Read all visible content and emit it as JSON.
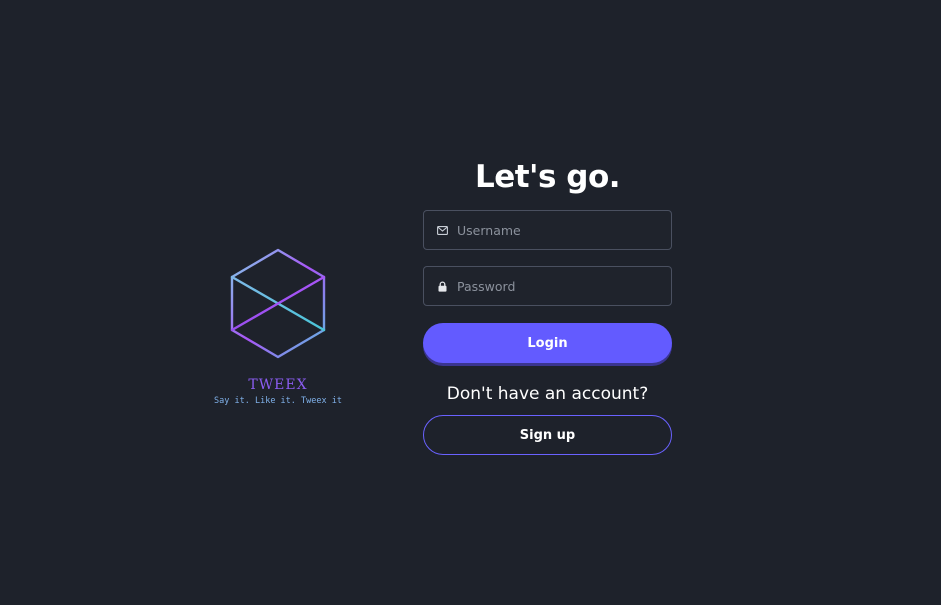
{
  "brand": {
    "name": "TWEEX",
    "tagline": "Say it. Like it. Tweex it",
    "logo_icon": "hexagon-cube-logo",
    "colors": {
      "name": "#8a5cf0",
      "tagline": "#7fb0e8",
      "logo_gradient_start": "#6fc3e6",
      "logo_gradient_end": "#a855f7"
    }
  },
  "form": {
    "heading": "Let's go.",
    "username": {
      "placeholder": "Username",
      "value": "",
      "icon": "mail-icon"
    },
    "password": {
      "placeholder": "Password",
      "value": "",
      "icon": "lock-icon"
    },
    "login_label": "Login",
    "signup_prompt": "Don't have an account?",
    "signup_label": "Sign up"
  },
  "colors": {
    "background": "#1e222b",
    "accent": "#635bff",
    "field_border": "#4a5060"
  }
}
